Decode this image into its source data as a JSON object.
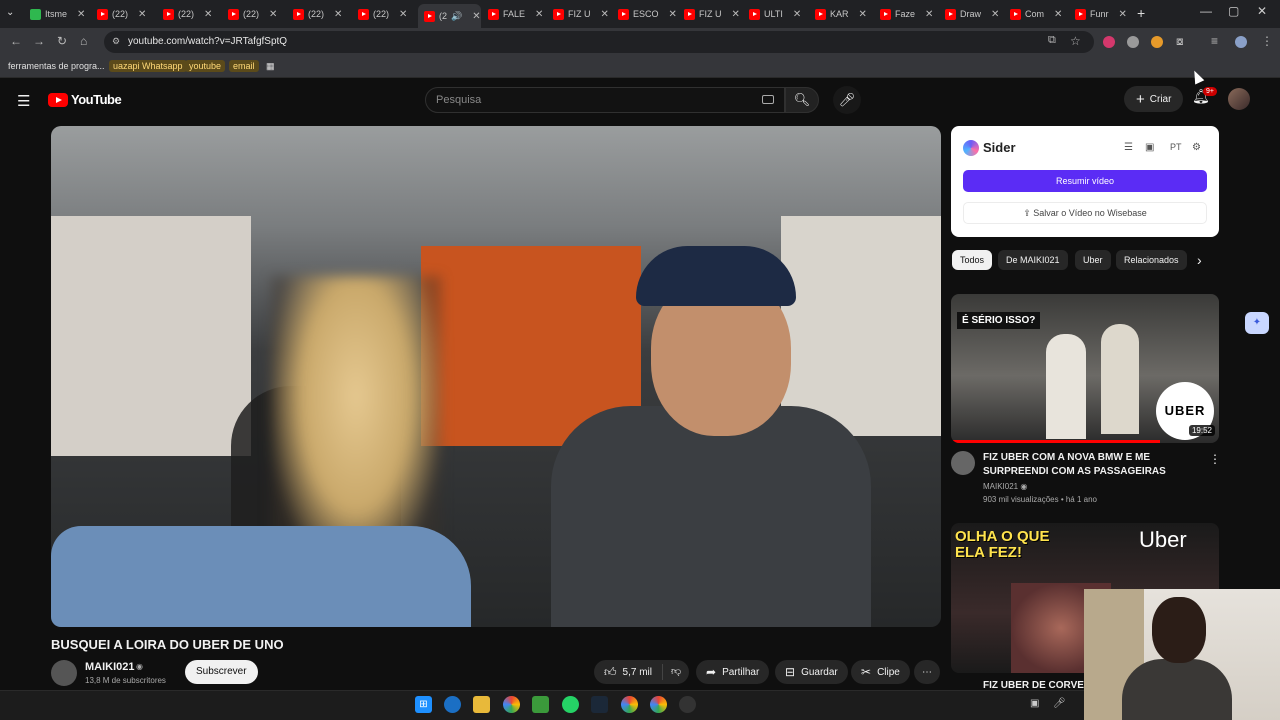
{
  "browser": {
    "tabs": [
      {
        "label": "Itsme",
        "active": false,
        "favicon": "green"
      },
      {
        "label": "(22)",
        "active": false
      },
      {
        "label": "(22)",
        "active": false
      },
      {
        "label": "(22)",
        "active": false
      },
      {
        "label": "(22)",
        "active": false
      },
      {
        "label": "(22)",
        "active": false
      },
      {
        "label": "(2",
        "active": true
      },
      {
        "label": "FALE",
        "active": false
      },
      {
        "label": "FIZ U",
        "active": false
      },
      {
        "label": "ESCO",
        "active": false
      },
      {
        "label": "FIZ U",
        "active": false
      },
      {
        "label": "ULTI",
        "active": false
      },
      {
        "label": "KAR",
        "active": false
      },
      {
        "label": "Faze",
        "active": false
      },
      {
        "label": "Draw",
        "active": false
      },
      {
        "label": "Com",
        "active": false
      },
      {
        "label": "Funr",
        "active": false
      }
    ],
    "url": "youtube.com/watch?v=JRTafgfSptQ",
    "bookmarks": [
      {
        "label": "ferramentas de progra...",
        "highlight": false
      },
      {
        "label": "uazapi Whatsapp",
        "highlight": true
      },
      {
        "label": "youtube",
        "highlight": true
      },
      {
        "label": "email",
        "highlight": true
      }
    ]
  },
  "youtube": {
    "logo_text": "YouTube",
    "search_placeholder": "Pesquisa",
    "create_label": "Criar",
    "notifications_badge": "9+"
  },
  "video": {
    "title": "BUSQUEI A LOIRA DO UBER DE UNO",
    "channel": "MAIKI021",
    "subscribers": "13,8 M de subscritores",
    "subscribe_label": "Subscrever",
    "likes": "5,7 mil",
    "share_label": "Partilhar",
    "save_label": "Guardar",
    "clip_label": "Clipe"
  },
  "sider": {
    "name": "Sider",
    "lang": "PT",
    "summarize_label": "Resumir vídeo",
    "save_label": "Salvar o Vídeo no Wisebase"
  },
  "chips": [
    "Todos",
    "De MAIKI021",
    "Uber",
    "Relacionados"
  ],
  "recommendations": [
    {
      "thumb_label": "É SÉRIO ISSO?",
      "thumb_brand": "UBER",
      "duration": "19:52",
      "watched_fraction": 0.78,
      "title": "FIZ UBER COM A NOVA BMW E ME SURPREENDI COM AS PASSAGEIRAS",
      "channel": "MAIKI021",
      "meta": "903 mil visualizações • há 1 ano"
    },
    {
      "thumb_label": "OLHA O QUE ELA FEZ!",
      "thumb_brand": "Uber",
      "title": "FIZ UBER DE CORVET"
    }
  ],
  "colors": {
    "background": "#0f0f0f",
    "youtube_red": "#ff0000",
    "sider_purple": "#5b2cf5"
  }
}
